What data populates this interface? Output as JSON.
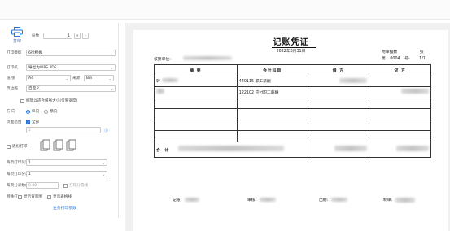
{
  "toolbar": {
    "print_label": "打印",
    "copies_label": "份数",
    "copies_value": "1",
    "plus": "+",
    "minus": "-"
  },
  "settings": {
    "template_label": "打印模版",
    "template_value": "6行模板",
    "printer_label": "打印机",
    "printer_value": "导出为WPS PDF",
    "paper_label": "纸 张",
    "paper_value": "A4",
    "source_label": "来源",
    "source_value": "Bin",
    "page_range_label": "页边距",
    "page_range_value": "自定义",
    "shrink_label": "缩放以适合纸张大小(仅限宽度)",
    "direction_label": "方 向",
    "portrait_label": "纵向",
    "landscape_label": "横向",
    "pages_label": "页面范围",
    "all_label": "全部",
    "page_input_value": "1",
    "duplex_label": "逐份打印",
    "per_page_label": "每页打印凭证数",
    "per_page_value": "1",
    "per_line_label": "每页打印分录数",
    "per_line_value": "1",
    "font_label": "每页分录数(mm)",
    "font_value": "0.00",
    "print_lines_label": "打印分隔线",
    "special_label": "特殊打",
    "show_bg_label": "显示背景图",
    "show_table_label": "显示表格线",
    "more_button": "业务打印参数"
  },
  "voucher": {
    "title": "记账凭证",
    "date": "2022年8月31日",
    "unit_label": "核算单位:",
    "attach_label": "附单据数",
    "attach_unit": "张",
    "number_label": "第",
    "number_value": "0004",
    "number_suffix": "号-",
    "page_fraction": "1/1",
    "headers": [
      "摘 要",
      "会计科目",
      "借 方",
      "贷 方"
    ],
    "rows": [
      {
        "summary": "转",
        "account": "440115 职工薪酬"
      },
      {
        "summary": "",
        "account": "122102 应付职工薪酬"
      },
      {
        "summary": "",
        "account": ""
      },
      {
        "summary": "",
        "account": ""
      },
      {
        "summary": "",
        "account": ""
      },
      {
        "summary": "",
        "account": ""
      }
    ],
    "total_label": "合 计",
    "bookkeeper_label": "记账:",
    "reviewer_label": "审核:",
    "cashier_label": "出纳:",
    "maker_label": "制单:"
  },
  "colors": {
    "accent": "#2b73d9"
  }
}
